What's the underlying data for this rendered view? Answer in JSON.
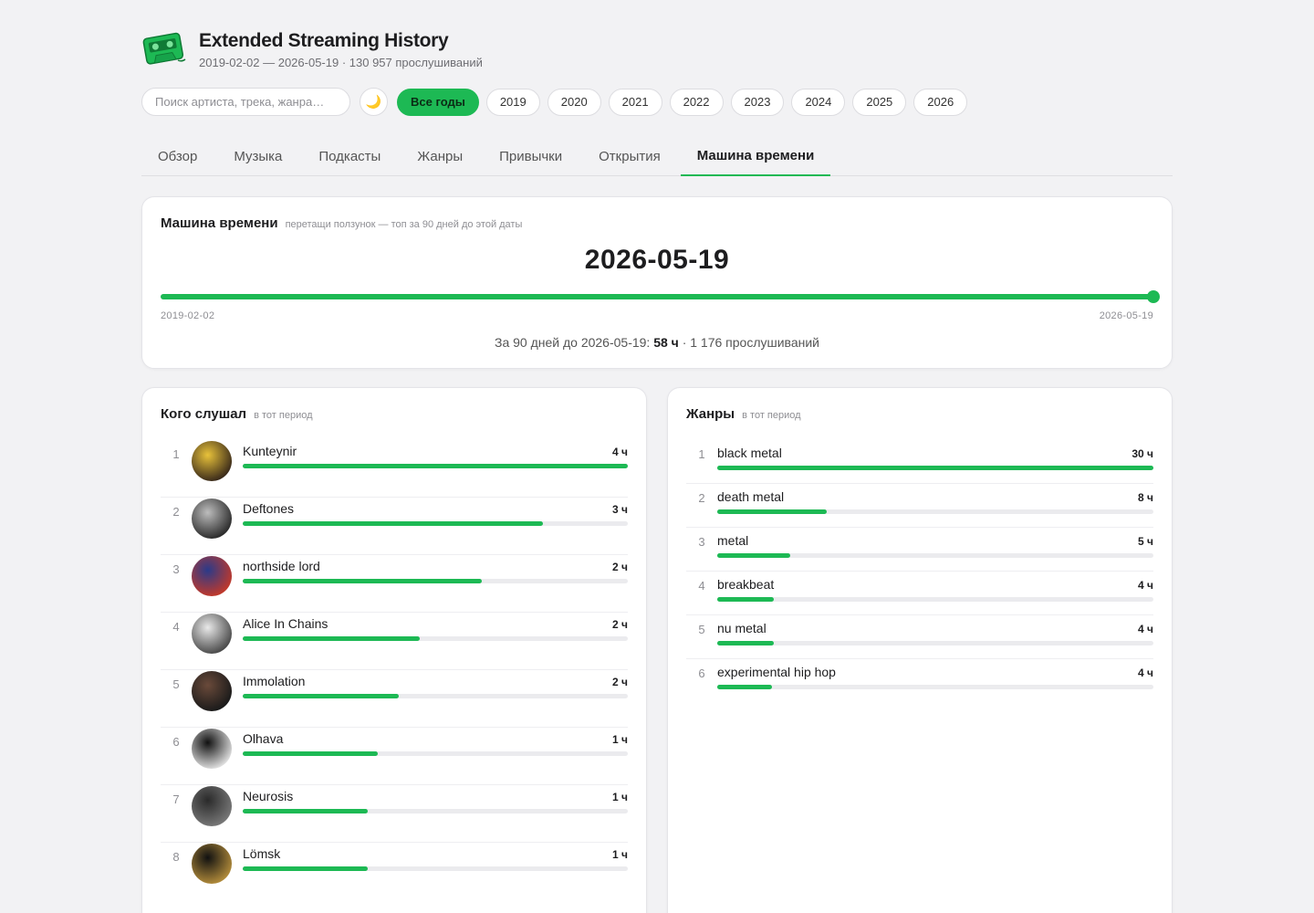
{
  "app": {
    "title": "Extended Streaming History",
    "subtitle": "2019-02-02 — 2026-05-19 · 130 957 прослушиваний",
    "logo_icon": "cassette-tape-icon",
    "accent_color": "#1db954"
  },
  "search": {
    "placeholder": "Поиск артиста, трека, жанра…",
    "value": ""
  },
  "theme_toggle": {
    "icon": "moon-icon",
    "glyph": "🌙"
  },
  "year_filter": {
    "selected": "Все годы",
    "options": [
      "Все годы",
      "2019",
      "2020",
      "2021",
      "2022",
      "2023",
      "2024",
      "2025",
      "2026"
    ]
  },
  "tabs": [
    {
      "label": "Обзор",
      "active": false
    },
    {
      "label": "Музыка",
      "active": false
    },
    {
      "label": "Подкасты",
      "active": false
    },
    {
      "label": "Жанры",
      "active": false
    },
    {
      "label": "Привычки",
      "active": false
    },
    {
      "label": "Открытия",
      "active": false
    },
    {
      "label": "Машина времени",
      "active": true
    }
  ],
  "time_machine": {
    "title": "Машина времени",
    "hint": "перетащи ползунок — топ за 90 дней до этой даты",
    "selected_date": "2026-05-19",
    "range_min": "2019-02-02",
    "range_max": "2026-05-19",
    "slider_position": 1.0,
    "summary_prefix": "За 90 дней до 2026-05-19:",
    "summary_hours": "58 ч",
    "summary_suffix": "· 1 176 прослушиваний"
  },
  "artists": {
    "title": "Кого слушал",
    "hint": "в тот период",
    "items": [
      {
        "rank": "1",
        "name": "Kunteynir",
        "value": "4 ч",
        "fraction": 1.0,
        "avatar_colors": [
          "#e8c23a",
          "#3a2a1a"
        ]
      },
      {
        "rank": "2",
        "name": "Deftones",
        "value": "3 ч",
        "fraction": 0.78,
        "avatar_colors": [
          "#bdbdbd",
          "#2b2b2b"
        ]
      },
      {
        "rank": "3",
        "name": "northside lord",
        "value": "2 ч",
        "fraction": 0.62,
        "avatar_colors": [
          "#2a3a8a",
          "#c0392b"
        ]
      },
      {
        "rank": "4",
        "name": "Alice In Chains",
        "value": "2 ч",
        "fraction": 0.46,
        "avatar_colors": [
          "#e9e9e9",
          "#4a4a4a"
        ]
      },
      {
        "rank": "5",
        "name": "Immolation",
        "value": "2 ч",
        "fraction": 0.405,
        "avatar_colors": [
          "#6a4a3a",
          "#1a1a1a"
        ]
      },
      {
        "rank": "6",
        "name": "Olhava",
        "value": "1 ч",
        "fraction": 0.35,
        "avatar_colors": [
          "#111111",
          "#dddddd"
        ]
      },
      {
        "rank": "7",
        "name": "Neurosis",
        "value": "1 ч",
        "fraction": 0.325,
        "avatar_colors": [
          "#2a2a2a",
          "#777777"
        ]
      },
      {
        "rank": "8",
        "name": "Lömsk",
        "value": "1 ч",
        "fraction": 0.325,
        "avatar_colors": [
          "#111111",
          "#b08a3a"
        ]
      }
    ]
  },
  "genres": {
    "title": "Жанры",
    "hint": "в тот период",
    "items": [
      {
        "rank": "1",
        "name": "black metal",
        "value": "30 ч",
        "fraction": 1.0
      },
      {
        "rank": "2",
        "name": "death metal",
        "value": "8 ч",
        "fraction": 0.25
      },
      {
        "rank": "3",
        "name": "metal",
        "value": "5 ч",
        "fraction": 0.167
      },
      {
        "rank": "4",
        "name": "breakbeat",
        "value": "4 ч",
        "fraction": 0.13
      },
      {
        "rank": "5",
        "name": "nu metal",
        "value": "4 ч",
        "fraction": 0.13
      },
      {
        "rank": "6",
        "name": "experimental hip hop",
        "value": "4 ч",
        "fraction": 0.125
      }
    ]
  }
}
